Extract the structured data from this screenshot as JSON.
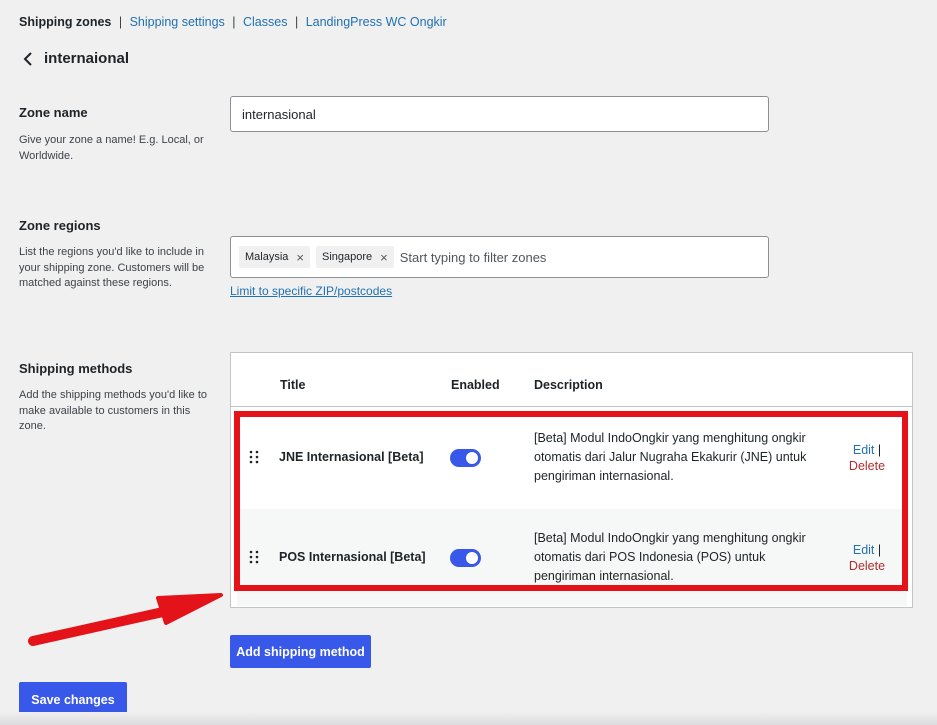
{
  "subnav": {
    "current": "Shipping zones",
    "links": [
      "Shipping settings",
      "Classes",
      "LandingPress WC Ongkir"
    ],
    "separator": "|"
  },
  "zone": {
    "back_icon": "chevron-left-icon",
    "title": "internaional"
  },
  "zone_name": {
    "label": "Zone name",
    "description": "Give your zone a name! E.g. Local, or Worldwide.",
    "value": "internasional"
  },
  "zone_regions": {
    "label": "Zone regions",
    "description": "List the regions you'd like to include in your shipping zone. Customers will be matched against these regions.",
    "chips": [
      "Malaysia",
      "Singapore"
    ],
    "chip_remove_symbol": "×",
    "placeholder": "Start typing to filter zones",
    "zip_link": "Limit to specific ZIP/postcodes"
  },
  "shipping_methods": {
    "label": "Shipping methods",
    "description": "Add the shipping methods you'd like to make available to customers in this zone.",
    "columns": {
      "title": "Title",
      "enabled": "Enabled",
      "description": "Description"
    },
    "rows": [
      {
        "title": "JNE Internasional [Beta]",
        "enabled": true,
        "description": "[Beta] Modul IndoOngkir yang menghitung ongkir otomatis dari Jalur Nugraha Ekakurir (JNE) untuk pengiriman internasional.",
        "edit": "Edit",
        "delete": "Delete"
      },
      {
        "title": "POS Internasional [Beta]",
        "enabled": true,
        "description": "[Beta] Modul IndoOngkir yang menghitung ongkir otomatis dari POS Indonesia (POS) untuk pengiriman internasional.",
        "edit": "Edit",
        "delete": "Delete"
      }
    ],
    "action_separator": "|",
    "add_button": "Add shipping method"
  },
  "save_button": "Save changes",
  "colors": {
    "accent": "#3858e9",
    "link": "#2271b1",
    "delete": "#b32d2e",
    "annotation": "#e4131a"
  }
}
